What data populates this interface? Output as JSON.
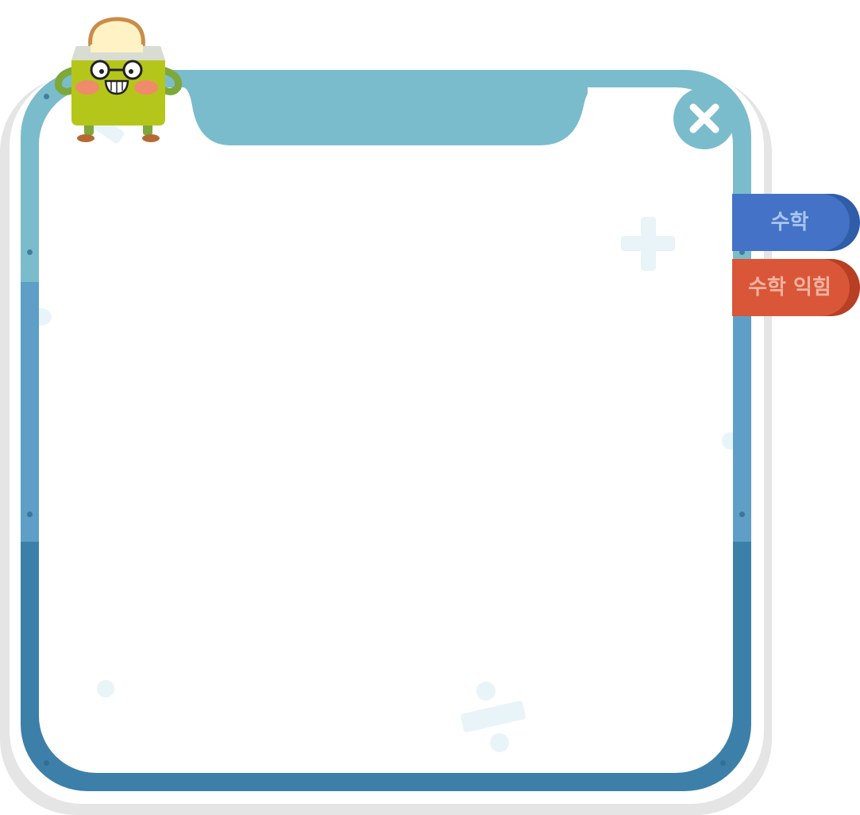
{
  "window": {
    "close_label": "close"
  },
  "tabs": [
    {
      "label": "수학",
      "color": "#4372c6"
    },
    {
      "label": "수학 익힘",
      "color": "#d95638"
    }
  ],
  "theme": {
    "frame_top": "#7bbccc",
    "frame_mid": "#5e9ec7",
    "frame_bottom": "#3c80a9",
    "panel": "#ffffff"
  },
  "icons": {
    "close": "close-icon",
    "mascot": "toaster-mascot"
  }
}
